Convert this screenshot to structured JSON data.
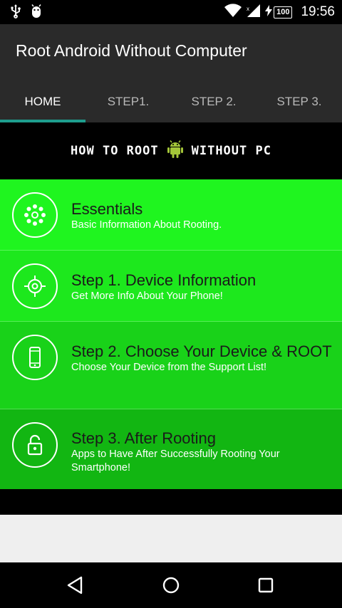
{
  "status_bar": {
    "time": "19:56",
    "battery": "100",
    "icons": [
      "usb-icon",
      "android-debug-icon",
      "wifi-icon",
      "signal-icon",
      "charging-icon"
    ]
  },
  "app": {
    "title": "Root Android Without Computer"
  },
  "tabs": [
    {
      "label": "HOME",
      "active": true
    },
    {
      "label": "STEP1.",
      "active": false
    },
    {
      "label": "STEP 2.",
      "active": false
    },
    {
      "label": "STEP 3.",
      "active": false
    }
  ],
  "banner": {
    "left": "HOW TO ROOT",
    "right": "WITHOUT PC"
  },
  "items": [
    {
      "title": "Essentials",
      "subtitle": "Basic Information About Rooting.",
      "icon": "dots-circle-icon",
      "color": "#1ff51f"
    },
    {
      "title": "Step 1. Device Information",
      "subtitle": "Get More Info About Your Phone!",
      "icon": "target-icon",
      "color": "#1de81d"
    },
    {
      "title": "Step 2. Choose Your Device & ROOT",
      "subtitle": "Choose Your Device from the Support List!",
      "icon": "phone-icon",
      "color": "#19d219"
    },
    {
      "title": "Step 3. After Rooting",
      "subtitle": "Apps to Have After Successfully Rooting Your Smartphone!",
      "icon": "unlock-icon",
      "color": "#12b612"
    }
  ],
  "colors": {
    "app_bar": "#2a2a2a",
    "tab_indicator": "#1e9e8e",
    "android_green": "#a4c639"
  },
  "nav": [
    "back-icon",
    "home-icon",
    "recents-icon"
  ]
}
